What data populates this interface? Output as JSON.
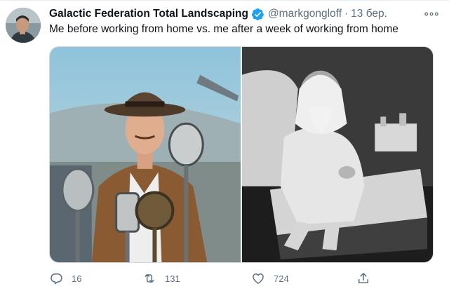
{
  "tweet": {
    "author": {
      "display_name": "Galactic Federation Total Landscaping",
      "handle": "@markgongloff",
      "verified": true,
      "avatar_icon": "profile-photo"
    },
    "separator": "·",
    "date": "13 бер.",
    "text": "Me before working from home vs. me after a week of working from home",
    "media": [
      {
        "alt_icon": "photo-man-in-fedora-at-microphones"
      },
      {
        "alt_icon": "photo-old-bearded-man-on-bed"
      }
    ],
    "actions": {
      "reply": {
        "icon": "reply-icon",
        "count": "16"
      },
      "retweet": {
        "icon": "retweet-icon",
        "count": "131"
      },
      "like": {
        "icon": "heart-icon",
        "count": "724"
      },
      "share": {
        "icon": "share-icon"
      }
    },
    "colors": {
      "verified": "#1da1f2",
      "secondary_text": "#5b7083",
      "primary_text": "#0f1419"
    }
  }
}
